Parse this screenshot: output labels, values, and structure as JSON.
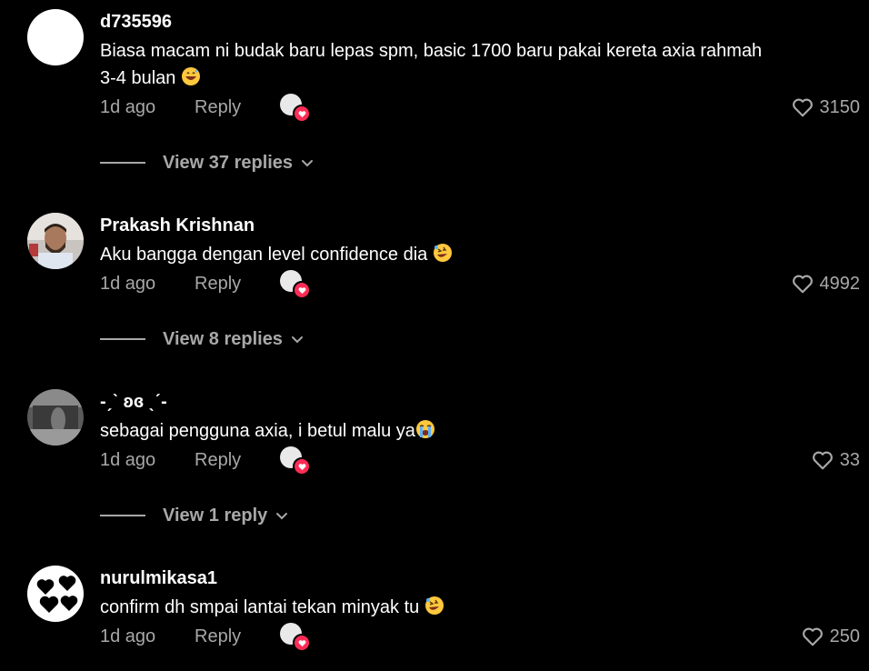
{
  "comments": [
    {
      "username": "d735596",
      "text_line1": "Biasa macam ni budak baru lepas spm, basic 1700 baru pakai kereta axia rahmah",
      "text_line2": "3-4 bulan",
      "emoji": "grinning-sweat-emoji",
      "time": "1d ago",
      "reply_label": "Reply",
      "likes": "3150",
      "view_replies": "View 37 replies"
    },
    {
      "username": "Prakash Krishnan",
      "text_line1": "Aku bangga dengan level confidence dia",
      "emoji": "rolling-laughing-emoji",
      "time": "1d ago",
      "reply_label": "Reply",
      "likes": "4992",
      "view_replies": "View 8 replies"
    },
    {
      "username": "-ˏˋ ʚɞ ˎˊ-",
      "text_line1": "sebagai pengguna axia, i betul malu ya",
      "emoji": "crying-emoji",
      "time": "1d ago",
      "reply_label": "Reply",
      "likes": "33",
      "view_replies": "View 1 reply"
    },
    {
      "username": "nurulmikasa1",
      "text_line1": "confirm dh smpai lantai tekan minyak tu",
      "emoji": "rolling-laughing-emoji",
      "time": "1d ago",
      "reply_label": "Reply",
      "likes": "250"
    }
  ],
  "colors": {
    "background": "#000000",
    "text": "#ffffff",
    "secondary": "#a8a8a8",
    "heart_badge": "#fe2c55"
  }
}
